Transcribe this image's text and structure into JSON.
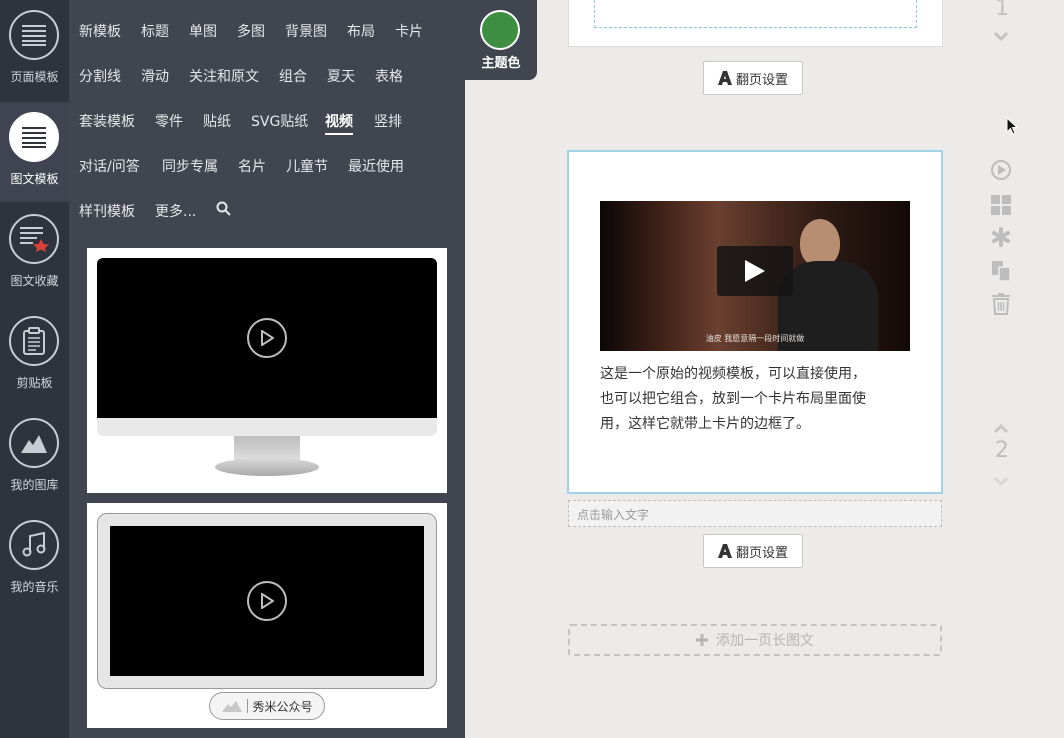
{
  "rail": {
    "items": [
      {
        "label": "页面模板",
        "icon": "lines-icon"
      },
      {
        "label": "图文模板",
        "icon": "lines-icon"
      },
      {
        "label": "图文收藏",
        "icon": "star-lines-icon"
      },
      {
        "label": "剪贴板",
        "icon": "clipboard-icon"
      },
      {
        "label": "我的图库",
        "icon": "mountain-icon"
      },
      {
        "label": "我的音乐",
        "icon": "music-note-icon"
      }
    ]
  },
  "tabs": {
    "row1": [
      "新模板",
      "标题",
      "单图",
      "多图",
      "背景图",
      "布局",
      "卡片"
    ],
    "row2": [
      "分割线",
      "滑动",
      "关注和原文",
      "组合",
      "夏天",
      "表格"
    ],
    "row3": [
      "套装模板",
      "零件",
      "贴纸",
      "SVG贴纸",
      "视频",
      "竖排"
    ],
    "row4": [
      "对话/问答",
      "同步专属",
      "名片",
      "儿童节",
      "最近使用"
    ],
    "row5": [
      "样刊模板",
      "更多..."
    ],
    "active": "视频"
  },
  "theme": {
    "label": "主题色",
    "color": "#3e8e41"
  },
  "templates": {
    "tablet_badge": "秀米公众号"
  },
  "editor": {
    "page1_number": "1",
    "page2_number": "2",
    "flip_label": "翻页设置",
    "video_subtitle": "油皮 我愿意隔一段时间就做",
    "body_lines": [
      "这是一个原始的视频模板，可以直接使用，",
      "也可以把它组合，放到一个卡片布局里面使",
      "用，这样它就带上卡片的边框了。"
    ],
    "text_placeholder": "点击输入文字",
    "add_page_label": "添加一页长图文"
  },
  "colors": {
    "accent_green": "#3e8e41",
    "selection_blue": "#9fd3e6"
  }
}
